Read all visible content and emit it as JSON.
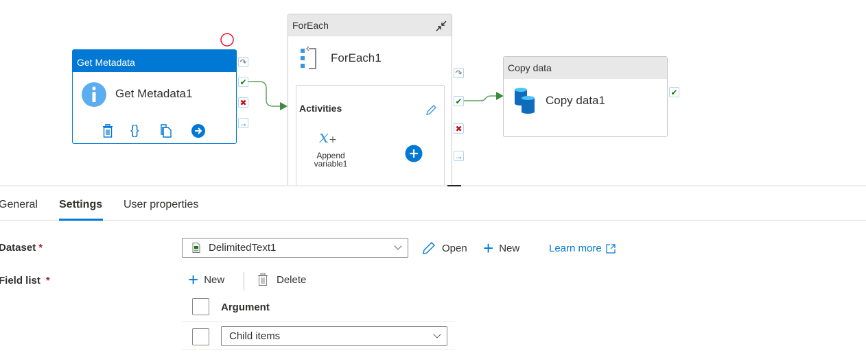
{
  "pipeline": {
    "activities": [
      {
        "type": "Get Metadata",
        "name": "Get Metadata1",
        "selected": true,
        "toolbar": [
          "delete-icon",
          "code-icon",
          "copy-icon",
          "next-icon"
        ]
      },
      {
        "type": "ForEach",
        "name": "ForEach1",
        "inner": {
          "title": "Activities",
          "items": [
            {
              "name_line1": "Append",
              "name_line2": "variable1",
              "icon": "x+"
            }
          ]
        }
      },
      {
        "type": "Copy data",
        "name": "Copy data1"
      }
    ],
    "ports": {
      "skip": "↷",
      "success": "✔",
      "failure": "✖",
      "completion": "→"
    },
    "colors": {
      "accent": "#0078d4",
      "success": "#107c10",
      "failure": "#c50f1f",
      "connector": "#5ea15e",
      "error_marker": "#e81123"
    }
  },
  "panel": {
    "tabs": [
      {
        "label": "General",
        "active": false
      },
      {
        "label": "Settings",
        "active": true
      },
      {
        "label": "User properties",
        "active": false
      }
    ],
    "dataset": {
      "label": "Dataset",
      "required": "*",
      "value": "DelimitedText1",
      "open_label": "Open",
      "new_label": "New",
      "learn_more": "Learn more"
    },
    "field_list": {
      "label": "Field list",
      "required": "*",
      "new_label": "New",
      "delete_label": "Delete",
      "column_header": "Argument",
      "rows": [
        {
          "value": "Child items"
        }
      ]
    }
  }
}
